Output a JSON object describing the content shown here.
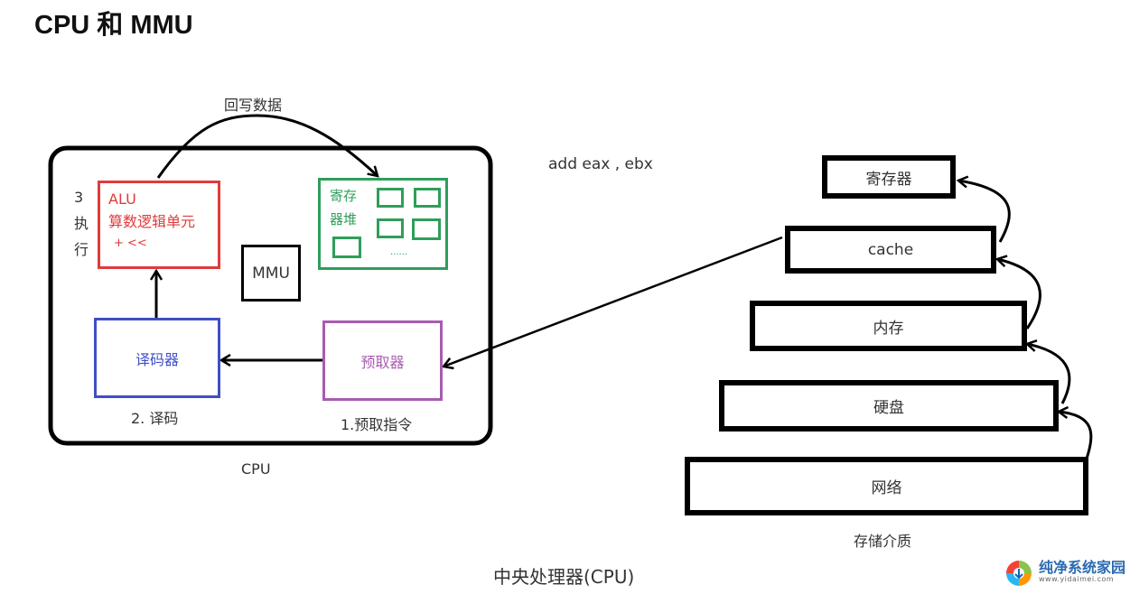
{
  "title": "CPU 和 MMU",
  "cpu": {
    "label": "CPU",
    "writeback_label": "回写数据",
    "execute_step": [
      "3",
      "执",
      "行"
    ],
    "alu": {
      "name": "ALU",
      "desc": "算数逻辑单元",
      "ops": "+ <<",
      "color": "#e03b3b"
    },
    "register_file": {
      "line1": "寄存",
      "line2": "器堆",
      "ellipsis": "......",
      "color": "#2e9e5b"
    },
    "mmu": {
      "label": "MMU"
    },
    "decoder": {
      "label": "译码器",
      "step": "2. 译码",
      "color": "#3f4fc4"
    },
    "prefetcher": {
      "label": "预取器",
      "step": "1.预取指令",
      "color": "#a85bb0"
    }
  },
  "instruction": "add eax , ebx",
  "storage": {
    "caption": "存储介质",
    "levels": [
      "寄存器",
      "cache",
      "内存",
      "硬盘",
      "网络"
    ]
  },
  "footer": "中央处理器(CPU)",
  "watermark": {
    "name": "纯净系统家园",
    "url": "www.yidaimei.com"
  }
}
